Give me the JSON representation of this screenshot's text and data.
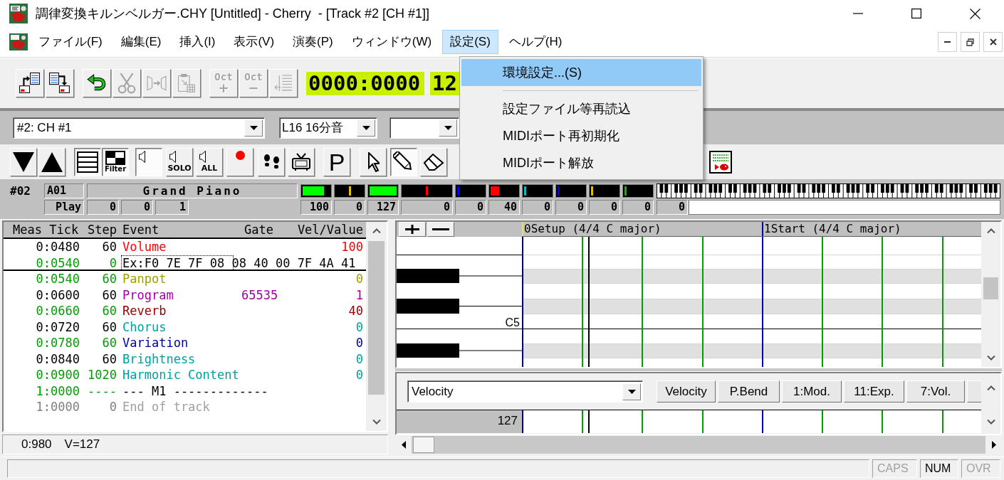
{
  "window": {
    "title": "調律変換キルンベルガー.CHY [Untitled] - Cherry  - [Track #2 [CH #1]]"
  },
  "menu_bar": {
    "items": [
      {
        "label": "ファイル(F)",
        "selected": false
      },
      {
        "label": "編集(E)",
        "selected": false
      },
      {
        "label": "挿入(I)",
        "selected": false
      },
      {
        "label": "表示(V)",
        "selected": false
      },
      {
        "label": "演奏(P)",
        "selected": false
      },
      {
        "label": "ウィンドウ(W)",
        "selected": false
      },
      {
        "label": "設定(S)",
        "selected": true
      },
      {
        "label": "ヘルプ(H)",
        "selected": false
      }
    ]
  },
  "settings_menu": {
    "items": [
      {
        "kind": "item",
        "label": "環境設定...(S)",
        "selected": true
      },
      {
        "kind": "separator"
      },
      {
        "kind": "item",
        "label": "設定ファイル等再読込",
        "selected": false
      },
      {
        "kind": "item",
        "label": "MIDIポート再初期化",
        "selected": false
      },
      {
        "kind": "item",
        "label": "MIDIポート解放",
        "selected": false
      }
    ]
  },
  "toolbar": {
    "buttons": [
      {
        "disabled": false
      },
      {
        "disabled": false
      },
      {
        "disabled": false
      },
      {
        "disabled": true
      },
      {
        "disabled": true
      },
      {
        "disabled": true
      },
      {
        "label": "Oct",
        "sign": "+",
        "disabled": true
      },
      {
        "label": "Oct",
        "sign": "−",
        "disabled": true
      },
      {
        "disabled": true
      }
    ],
    "position": "0000:0000",
    "tempo": "12"
  },
  "track_panel": {
    "track_combo": "#2: CH #1",
    "length_combo": "L16 16分音",
    "tools": [
      {
        "pressed": false
      },
      {
        "pressed": false
      },
      {
        "pressed": true
      },
      {
        "label": "Filter",
        "pressed": true
      },
      {
        "pressed": true
      },
      {
        "label": "SOLO",
        "pressed": false
      },
      {
        "label": "ALL",
        "pressed": false
      },
      {
        "pressed": false
      },
      {
        "pressed": false
      },
      {
        "pressed": false
      },
      {
        "label": "P",
        "pressed": false
      },
      {
        "pressed": false
      },
      {
        "pressed": true
      },
      {
        "pressed": false
      },
      {
        "pressed": false
      }
    ],
    "track_no": "#02",
    "patch": "A01",
    "instrument": "Grand Piano",
    "mode": "Play",
    "counters": [
      "0",
      "0",
      "1"
    ],
    "meters": [
      {
        "value": "100",
        "kind": "bar",
        "level": 0.79,
        "color": "#00ff00"
      },
      {
        "value": "0",
        "kind": "center",
        "color": "#e0c000"
      },
      {
        "value": "127",
        "kind": "bar",
        "level": 1,
        "color": "#00ff00"
      },
      {
        "value": "0",
        "kind": "center",
        "color": "#ff0000"
      },
      {
        "value": "0",
        "kind": "start",
        "color": "#0000ff"
      },
      {
        "value": "40",
        "kind": "bar",
        "level": 0.31,
        "color": "#ff0000"
      },
      {
        "value": "0",
        "kind": "start",
        "color": "#00c0c0"
      },
      {
        "value": "0",
        "kind": "start",
        "color": "#0000ff"
      },
      {
        "value": "0",
        "kind": "start",
        "color": "#e0c000"
      },
      {
        "value": "0",
        "kind": "start",
        "color": "#00c000"
      }
    ],
    "key_value": "0"
  },
  "event_list": {
    "columns": [
      "Meas Tick",
      "Step",
      "Event",
      "Gate",
      "Vel/Value"
    ],
    "rows": [
      {
        "kind": "event",
        "time": {
          "text": "0:0480",
          "color": "#000000"
        },
        "step": "60",
        "event": {
          "text": "Volume",
          "color": "#ff0000"
        },
        "value": "100",
        "focused": false,
        "cursor_after": false
      },
      {
        "kind": "sysex",
        "time": {
          "text": "0:0540",
          "color": "#00a000"
        },
        "step": "0",
        "event": {
          "text": "Ex:F0 7E 7F 08 08 40 00 7F 4A 41",
          "color": "#000000"
        },
        "focused": true,
        "cursor_after": true
      },
      {
        "kind": "event",
        "time": {
          "text": "0:0540",
          "color": "#00a000"
        },
        "step": "60",
        "event": {
          "text": "Panpot",
          "color": "#a0a000"
        },
        "value": "0",
        "focused": false,
        "cursor_after": false
      },
      {
        "kind": "event",
        "time": {
          "text": "0:0600",
          "color": "#000000"
        },
        "step": "60",
        "event": {
          "text": "Program",
          "color": "#a000a0"
        },
        "gate": "65535",
        "value": "1",
        "focused": false,
        "cursor_after": false
      },
      {
        "kind": "event",
        "time": {
          "text": "0:0660",
          "color": "#00a000"
        },
        "step": "60",
        "event": {
          "text": "Reverb",
          "color": "#a00000"
        },
        "value": "40",
        "focused": false,
        "cursor_after": false
      },
      {
        "kind": "event",
        "time": {
          "text": "0:0720",
          "color": "#000000"
        },
        "step": "60",
        "event": {
          "text": "Chorus",
          "color": "#00a0a0"
        },
        "value": "0",
        "focused": false,
        "cursor_after": false
      },
      {
        "kind": "event",
        "time": {
          "text": "0:0780",
          "color": "#00a000"
        },
        "step": "60",
        "event": {
          "text": "Variation",
          "color": "#0000a0"
        },
        "value": "0",
        "focused": false,
        "cursor_after": false
      },
      {
        "kind": "event",
        "time": {
          "text": "0:0840",
          "color": "#000000"
        },
        "step": "60",
        "event": {
          "text": "Brightness",
          "color": "#00a0a0"
        },
        "value": "0",
        "focused": false,
        "cursor_after": false
      },
      {
        "kind": "event",
        "time": {
          "text": "0:0900",
          "color": "#00a000"
        },
        "step": "1020",
        "event": {
          "text": "Harmonic Content",
          "color": "#00a0a0"
        },
        "value": "0",
        "focused": false,
        "cursor_after": false
      },
      {
        "kind": "measure",
        "time": {
          "text": "1:0000",
          "color": "#00a000"
        },
        "step": "----",
        "event": {
          "text": "--- M1 -------------",
          "color": "#000000"
        },
        "focused": false,
        "cursor_after": false
      },
      {
        "kind": "event",
        "time": {
          "text": "1:0000",
          "color": "#808080"
        },
        "step": "0",
        "event": {
          "text": "End of track",
          "color": "#a0a0a0"
        },
        "focused": false,
        "cursor_after": false
      }
    ],
    "status": [
      "0:980",
      "V=127"
    ]
  },
  "piano_roll": {
    "measures": [
      "0Setup (4/4 C major)",
      "1Start (4/4 C major)"
    ],
    "note_label": "C5",
    "controller_combo": "Velocity",
    "controller_buttons": [
      "Velocity",
      "P.Bend",
      "1:Mod.",
      "11:Exp.",
      "7:Vol."
    ],
    "velocity_value": "127"
  },
  "status_bar": {
    "indicators": [
      {
        "label": "CAPS",
        "on": false
      },
      {
        "label": "NUM",
        "on": true
      },
      {
        "label": "OVR",
        "on": false
      }
    ]
  }
}
